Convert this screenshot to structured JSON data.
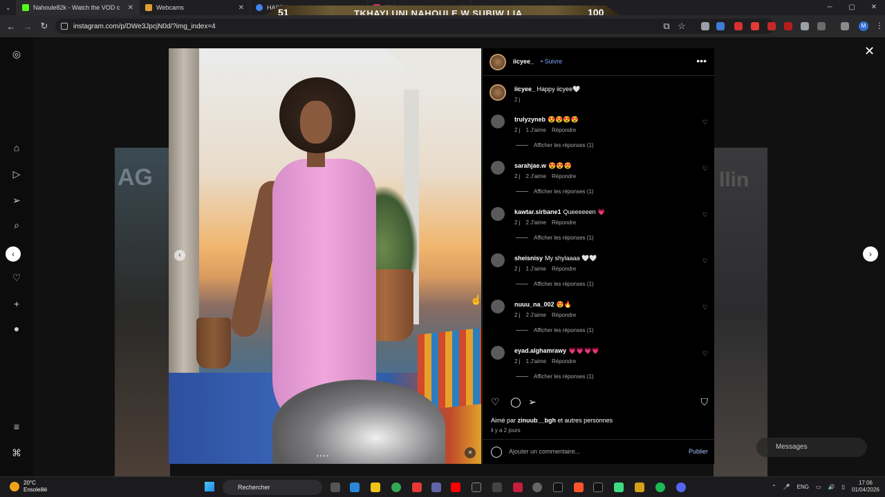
{
  "browser": {
    "tabs": [
      {
        "label": "Nahoule82k - Watch the VOD c",
        "color": "#53fc18"
      },
      {
        "label": "Webcams",
        "color": "#e0a030"
      },
      {
        "label": "HASBU",
        "color": "#4285f4"
      },
      {
        "label": "(4) Instagram",
        "color": "#d62976"
      }
    ],
    "url": "instagram.com/p/DWe3JpcjN0d/?img_index=4",
    "profile_initial": "M",
    "overlay": {
      "left_num": "51",
      "title": "TKHAYLUNI NAHOULE W SUBIW LIA",
      "right_num": "100"
    }
  },
  "post": {
    "username": "iicyee_",
    "follow_label": "Suivre",
    "caption_user": "iicyee_",
    "caption_text": "Happy iicyee🤍",
    "caption_time": "2 j",
    "comments": [
      {
        "user": "trulyzyneb",
        "text": "😍😍😍😍",
        "time": "2 j",
        "likes": "1 J'aime",
        "reply": "Répondre",
        "view_replies": "Afficher les réponses (1)"
      },
      {
        "user": "sarahjae.w",
        "text": "😍😍😍",
        "time": "2 j",
        "likes": "2 J'aime",
        "reply": "Répondre",
        "view_replies": "Afficher les réponses (1)"
      },
      {
        "user": "kawtar.sirbane1",
        "text": "Queeeeeen 💗",
        "time": "2 j",
        "likes": "2 J'aime",
        "reply": "Répondre",
        "view_replies": "Afficher les réponses (1)"
      },
      {
        "user": "sheisnisy",
        "text": "My shylaaaa 🤍🤍",
        "time": "2 j",
        "likes": "1 J'aime",
        "reply": "Répondre",
        "view_replies": "Afficher les réponses (1)"
      },
      {
        "user": "nuuu_na_002",
        "text": "😍🔥",
        "time": "2 j",
        "likes": "2 J'aime",
        "reply": "Répondre",
        "view_replies": "Afficher les réponses (1)"
      },
      {
        "user": "eyad.alghamrawy",
        "text": "💗💗💗💗",
        "time": "2 j",
        "likes": "1 J'aime",
        "reply": "Répondre",
        "view_replies": "Afficher les réponses (1)"
      }
    ],
    "liked_prefix": "Aimé par",
    "liked_user": "zinuub__bgh",
    "liked_suffix": "et autres personnes",
    "posted_ago": "il y a 2 jours",
    "comment_placeholder": "Ajouter un commentaire...",
    "publish_label": "Publier",
    "image_dots": "••••"
  },
  "messages_label": "Messages",
  "taskbar": {
    "temperature": "20°C",
    "weather": "Ensoleillé",
    "search_label": "Rechercher",
    "lang": "ENG",
    "time": "17:06",
    "date": "01/04/2026"
  },
  "colors": {
    "accent_follow": "#7ba6ff",
    "panel_bg": "#000000"
  }
}
